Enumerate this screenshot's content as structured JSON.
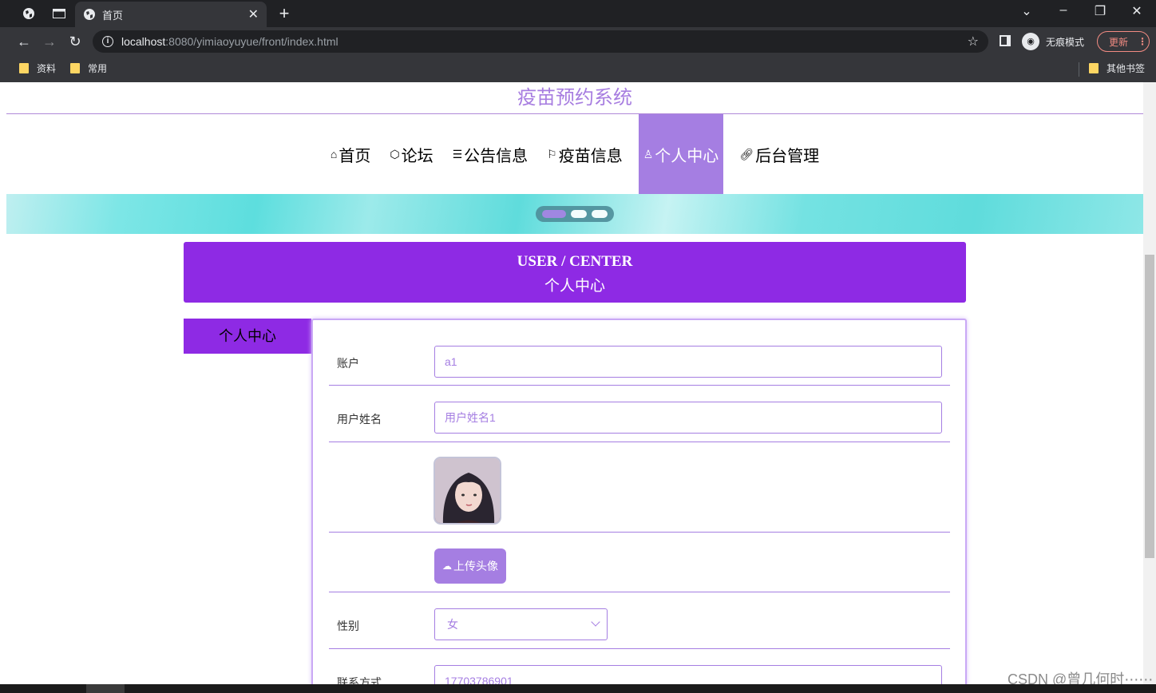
{
  "browser": {
    "tab_title": "首页",
    "url_host": "localhost",
    "url_path": ":8080/yimiaoyuyue/front/index.html",
    "incognito_label": "无痕模式",
    "update_label": "更新",
    "bookmarks": [
      "资料",
      "常用"
    ],
    "other_bookmarks": "其他书签"
  },
  "site": {
    "title": "疫苗预约系统",
    "nav": [
      {
        "label": "首页",
        "icon": "home-icon"
      },
      {
        "label": "论坛",
        "icon": "tag-icon"
      },
      {
        "label": "公告信息",
        "icon": "sliders-icon"
      },
      {
        "label": "疫苗信息",
        "icon": "flag-icon"
      },
      {
        "label": "个人中心",
        "icon": "user-icon",
        "active": true
      },
      {
        "label": "后台管理",
        "icon": "link-icon"
      }
    ]
  },
  "user_center": {
    "title_en": "USER / CENTER",
    "title_cn": "个人中心",
    "side_tab": "个人中心"
  },
  "form": {
    "account_label": "账户",
    "account_value": "a1",
    "name_label": "用户姓名",
    "name_value": "用户姓名1",
    "upload_label": "上传头像",
    "gender_label": "性别",
    "gender_value": "女",
    "phone_label": "联系方式",
    "phone_value": "17703786901"
  },
  "colors": {
    "accent": "#a57ee2",
    "header_purple": "#8e2ae4"
  },
  "watermark": "CSDN @曾几何时⋯⋯"
}
